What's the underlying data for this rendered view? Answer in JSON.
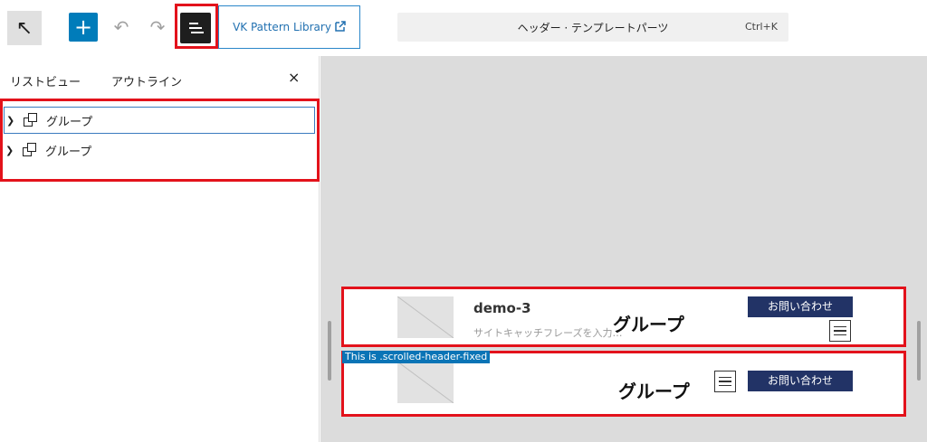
{
  "toolbar": {
    "vk_label": "VK Pattern Library",
    "search_text": "ヘッダー · テンプレートパーツ",
    "shortcut": "Ctrl+K"
  },
  "panel": {
    "tab_list": "リストビュー",
    "tab_outline": "アウトライン",
    "close": "×",
    "items": [
      {
        "label": "グループ"
      },
      {
        "label": "グループ"
      }
    ]
  },
  "canvas": {
    "site_title": "demo-3",
    "tagline": "サイトキャッチフレーズを入力…",
    "group_label": "グループ",
    "contact_label": "お問い合わせ",
    "fixed_note": "This is .scrolled-header-fixed"
  },
  "colors": {
    "accent": "#007cba",
    "highlight": "#e3121b",
    "contact_bg": "#223366"
  }
}
